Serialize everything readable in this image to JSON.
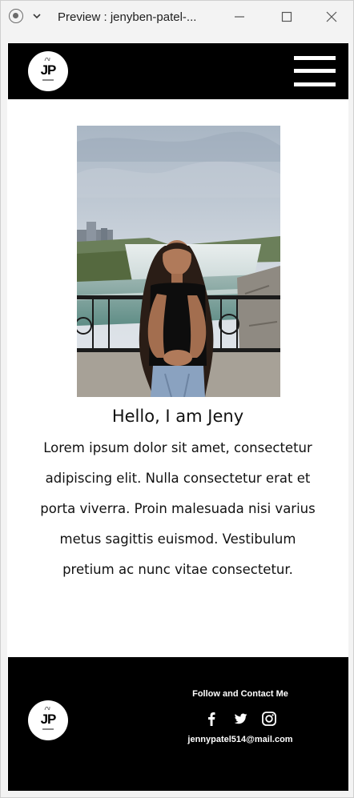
{
  "window": {
    "title": "Preview : jenyben-patel-..."
  },
  "header": {
    "logo_text": "JP"
  },
  "hero": {
    "heading": "Hello, I am Jeny",
    "intro": "Lorem ipsum dolor sit amet, consectetur adipiscing elit. Nulla consectetur erat et porta viverra. Proin malesuada nisi varius metus sagittis euismod. Vestibulum pretium ac nunc vitae consectetur."
  },
  "footer": {
    "logo_text": "JP",
    "follow_heading": "Follow and Contact Me",
    "social": [
      {
        "icon": "facebook-icon"
      },
      {
        "icon": "twitter-icon"
      },
      {
        "icon": "instagram-icon"
      }
    ],
    "email": "jennypatel514@mail.com"
  },
  "colors": {
    "header_bg": "#000000",
    "footer_bg": "#000000",
    "text": "#111111"
  }
}
